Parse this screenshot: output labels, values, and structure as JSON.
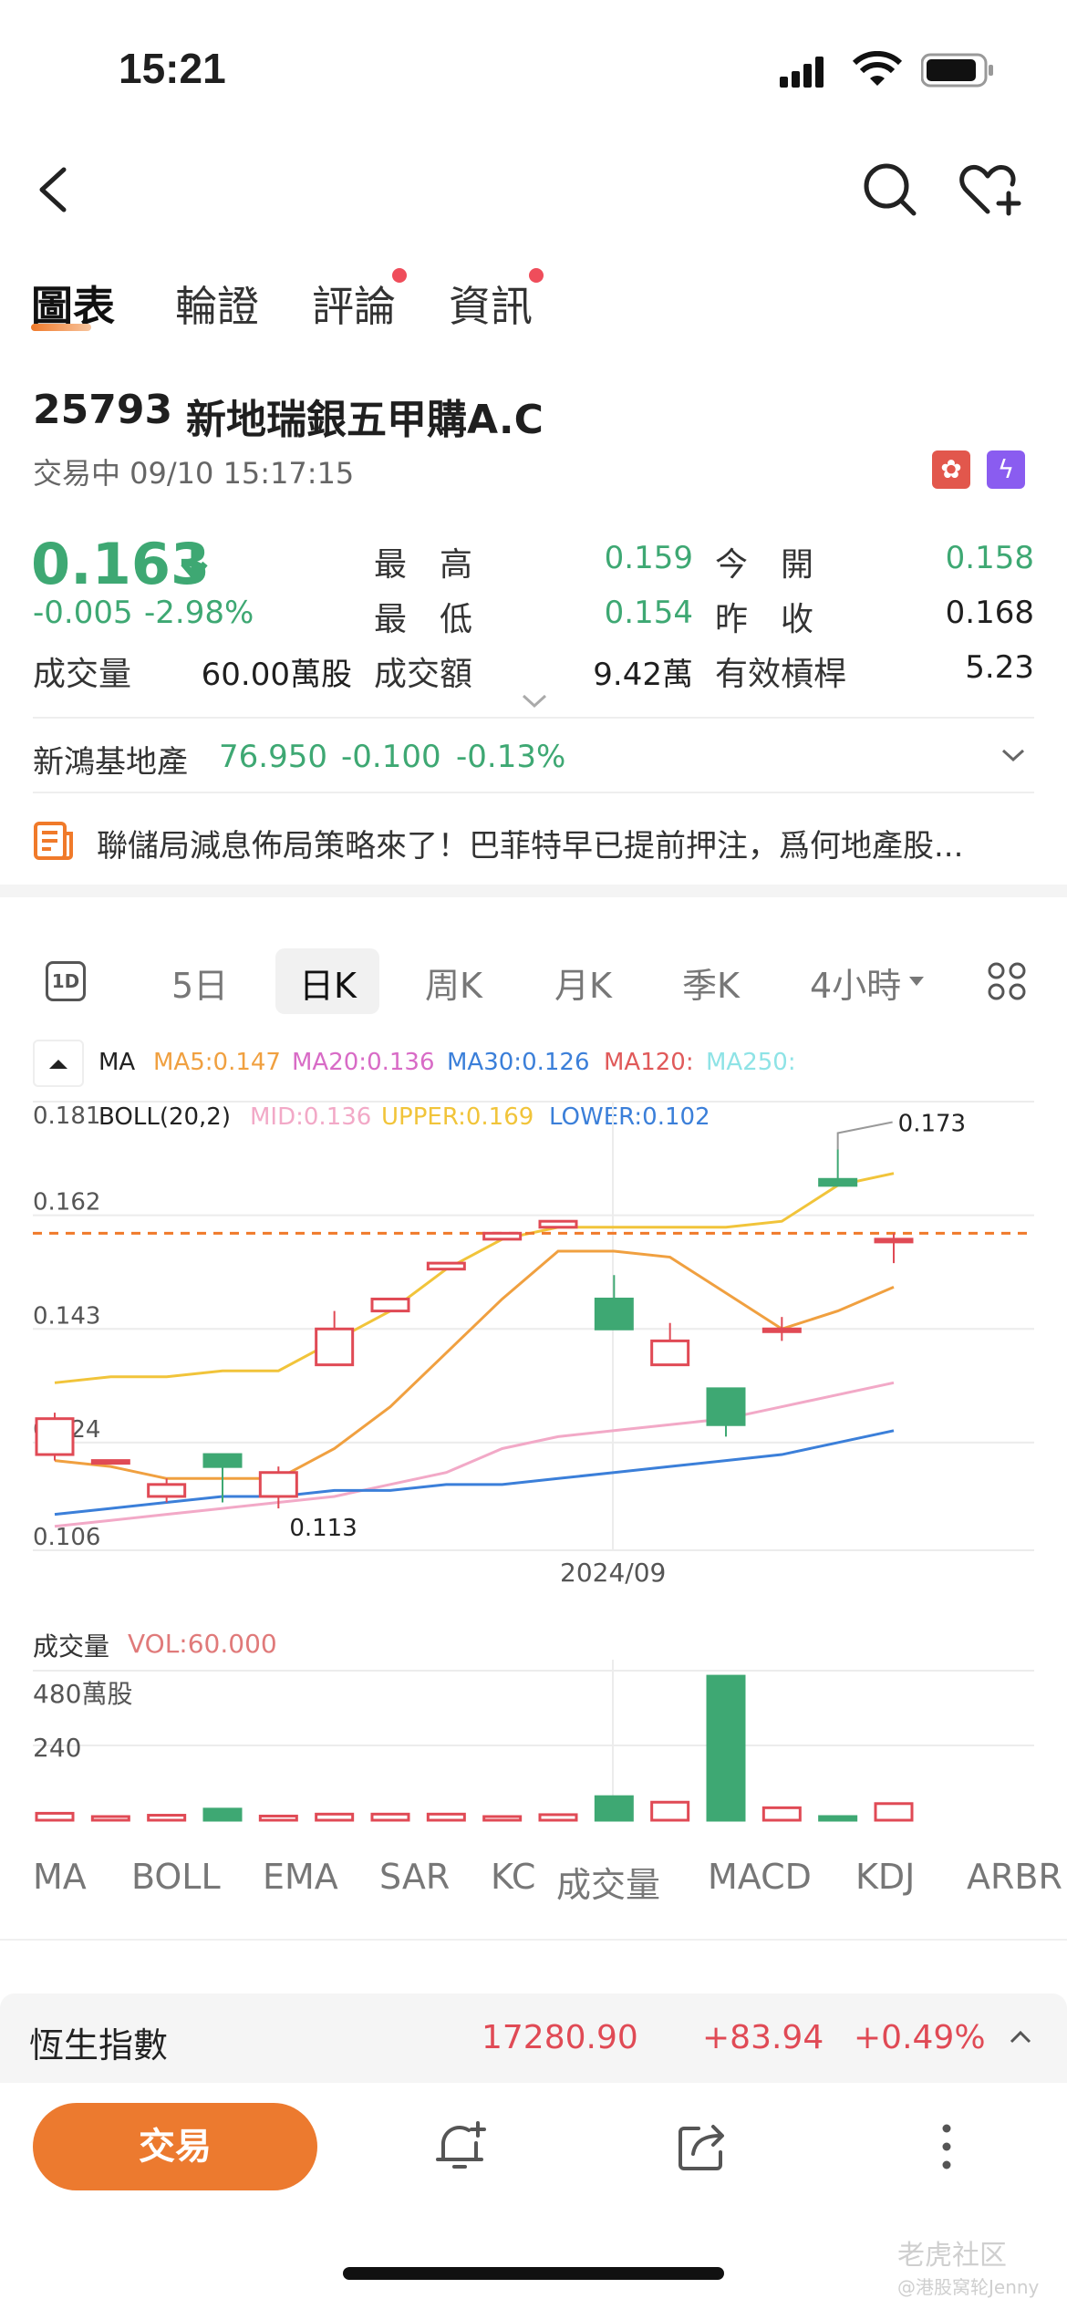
{
  "status": {
    "time": "15:21"
  },
  "tabs": [
    {
      "label": "圖表"
    },
    {
      "label": "輪證"
    },
    {
      "label": "評論"
    },
    {
      "label": "資訊"
    }
  ],
  "stock": {
    "code": "25793",
    "name": "新地瑞銀五甲購A.C",
    "status": "交易中 09/10 15:17:15",
    "price": "0.163",
    "change": "-0.005",
    "change_pct": "-2.98%",
    "high_label": "最　高",
    "high": "0.159",
    "low_label": "最　低",
    "low": "0.154",
    "open_label": "今　開",
    "open": "0.158",
    "prev_label": "昨　收",
    "prev": "0.168",
    "vol_label": "成交量",
    "vol": "60.00萬股",
    "turnover_label": "成交額",
    "turnover": "9.42萬",
    "leverage_label": "有效槓桿",
    "leverage": "5.23"
  },
  "underlying": {
    "name": "新鴻基地產",
    "price": "76.950",
    "change": "-0.100",
    "change_pct": "-0.13%"
  },
  "news": {
    "text": "聯儲局減息佈局策略來了！巴菲特早已提前押注，爲何地產股..."
  },
  "range_tabs": [
    {
      "label": "1D"
    },
    {
      "label": "5日"
    },
    {
      "label": "日K"
    },
    {
      "label": "周K"
    },
    {
      "label": "月K"
    },
    {
      "label": "季K"
    },
    {
      "label": "4小時"
    }
  ],
  "ma_legend": {
    "label": "MA",
    "ma5": "MA5:0.147",
    "ma20": "MA20:0.136",
    "ma30": "MA30:0.126",
    "ma120": "MA120:",
    "ma250": "MA250:"
  },
  "boll_legend": {
    "label": "BOLL(20,2)",
    "mid": "MID:0.136",
    "upper": "UPPER:0.169",
    "lower": "LOWER:0.102"
  },
  "chart_data": {
    "type": "candlestick",
    "y_ticks": [
      "0.181",
      "0.162",
      "0.143",
      "0.124",
      "0.106"
    ],
    "ylim": [
      0.106,
      0.181
    ],
    "x_label": "2024/09",
    "annotations": [
      "0.173",
      "0.113"
    ],
    "last_price_line": 0.159,
    "candles": [
      {
        "o": 0.122,
        "c": 0.128,
        "h": 0.129,
        "l": 0.121
      },
      {
        "o": 0.121,
        "c": 0.121,
        "h": 0.121,
        "l": 0.121
      },
      {
        "o": 0.115,
        "c": 0.117,
        "h": 0.118,
        "l": 0.114
      },
      {
        "o": 0.122,
        "c": 0.12,
        "h": 0.122,
        "l": 0.114
      },
      {
        "o": 0.115,
        "c": 0.119,
        "h": 0.12,
        "l": 0.113
      },
      {
        "o": 0.137,
        "c": 0.143,
        "h": 0.146,
        "l": 0.137
      },
      {
        "o": 0.146,
        "c": 0.148,
        "h": 0.148,
        "l": 0.146
      },
      {
        "o": 0.153,
        "c": 0.154,
        "h": 0.154,
        "l": 0.153
      },
      {
        "o": 0.158,
        "c": 0.159,
        "h": 0.159,
        "l": 0.158
      },
      {
        "o": 0.16,
        "c": 0.161,
        "h": 0.161,
        "l": 0.16
      },
      {
        "o": 0.148,
        "c": 0.143,
        "h": 0.152,
        "l": 0.143
      },
      {
        "o": 0.137,
        "c": 0.141,
        "h": 0.144,
        "l": 0.137
      },
      {
        "o": 0.133,
        "c": 0.127,
        "h": 0.133,
        "l": 0.125
      },
      {
        "o": 0.143,
        "c": 0.143,
        "h": 0.145,
        "l": 0.141
      },
      {
        "o": 0.168,
        "c": 0.167,
        "h": 0.173,
        "l": 0.167
      },
      {
        "o": 0.158,
        "c": 0.158,
        "h": 0.159,
        "l": 0.154
      }
    ],
    "series": [
      {
        "name": "MA5",
        "values": [
          0.121,
          0.12,
          0.118,
          0.118,
          0.118,
          0.123,
          0.13,
          0.139,
          0.148,
          0.156,
          0.156,
          0.155,
          0.149,
          0.143,
          0.146,
          0.15
        ]
      },
      {
        "name": "UPPER",
        "values": [
          0.134,
          0.135,
          0.135,
          0.136,
          0.136,
          0.141,
          0.146,
          0.153,
          0.158,
          0.16,
          0.16,
          0.16,
          0.16,
          0.161,
          0.167,
          0.169
        ]
      },
      {
        "name": "MID",
        "values": [
          0.11,
          0.111,
          0.112,
          0.113,
          0.114,
          0.115,
          0.117,
          0.119,
          0.123,
          0.125,
          0.126,
          0.127,
          0.128,
          0.13,
          0.132,
          0.134
        ]
      },
      {
        "name": "LOWER",
        "values": [
          0.112,
          0.113,
          0.114,
          0.115,
          0.115,
          0.116,
          0.116,
          0.117,
          0.117,
          0.118,
          0.119,
          0.12,
          0.121,
          0.122,
          0.124,
          0.126
        ]
      }
    ]
  },
  "volume": {
    "label": "成交量",
    "vol_text": "VOL:60.000",
    "ticks": [
      "480萬股",
      "240"
    ],
    "values": [
      25,
      3,
      18,
      40,
      15,
      22,
      22,
      22,
      12,
      20,
      85,
      65,
      520,
      45,
      10,
      60
    ]
  },
  "indicator_tabs": [
    {
      "label": "MA"
    },
    {
      "label": "BOLL"
    },
    {
      "label": "EMA"
    },
    {
      "label": "SAR"
    },
    {
      "label": "KC"
    },
    {
      "label": "成交量"
    },
    {
      "label": "MACD"
    },
    {
      "label": "KDJ"
    },
    {
      "label": "ARBR"
    }
  ],
  "index_bar": {
    "name": "恆生指數",
    "price": "17280.90",
    "change": "+83.94",
    "change_pct": "+0.49%"
  },
  "bottom": {
    "trade_label": "交易"
  },
  "watermark": {
    "brand": "老虎社区",
    "user": "@港股窝轮Jenny"
  },
  "colors": {
    "green": "#3ea873",
    "red": "#e04a55",
    "orange": "#f07a2a",
    "ma5": "#f0a040",
    "ma20": "#d86bc6",
    "ma30": "#3b7fd9",
    "ma120": "#e05a5a",
    "ma250": "#8ee3e6",
    "mid": "#f2a9c7",
    "upper": "#f1c43a",
    "lower": "#3b7fd9"
  }
}
